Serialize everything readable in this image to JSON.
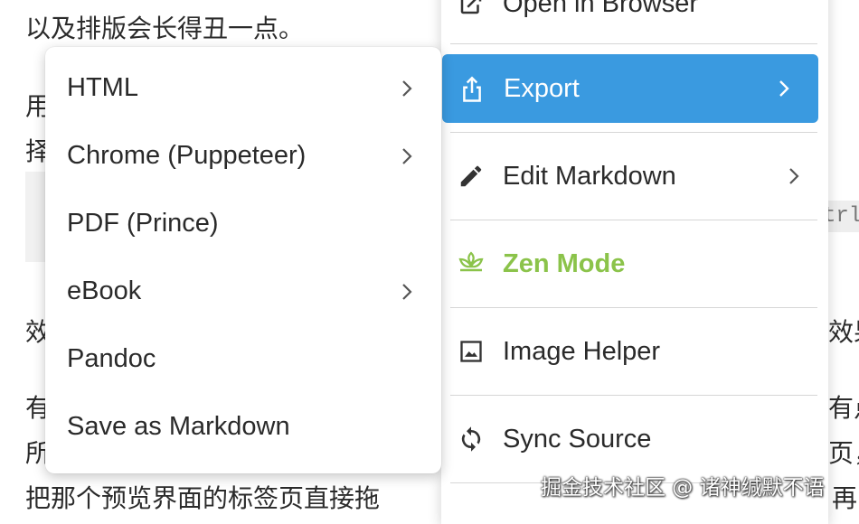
{
  "document": {
    "line_top": "以及排版会长得丑一点。",
    "frag_left_1": "用",
    "frag_left_2": "择",
    "frag_left_3": "效",
    "frag_left_4": "有",
    "frag_left_5": "所",
    "line_bottom": "把那个预览界面的标签页直接拖",
    "frag_right_1": "效果",
    "frag_right_2": "有点",
    "frag_right_3": "页，",
    "frag_right_4": "再",
    "kbd_fragment": "trl+"
  },
  "submenu": {
    "items": [
      {
        "label": "HTML",
        "has_submenu": true
      },
      {
        "label": "Chrome (Puppeteer)",
        "has_submenu": true
      },
      {
        "label": "PDF (Prince)",
        "has_submenu": false
      },
      {
        "label": "eBook",
        "has_submenu": true
      },
      {
        "label": "Pandoc",
        "has_submenu": false
      },
      {
        "label": "Save as Markdown",
        "has_submenu": false
      }
    ]
  },
  "mainmenu": {
    "open_in_browser": "Open in Browser",
    "export": "Export",
    "edit_markdown": "Edit Markdown",
    "zen_mode": "Zen Mode",
    "image_helper": "Image Helper",
    "sync_source": "Sync Source"
  },
  "colors": {
    "active_bg": "#3a9ae0",
    "zen_green": "#8bc34a"
  },
  "watermark": "掘金技术社区 @ 诸神缄默不语"
}
